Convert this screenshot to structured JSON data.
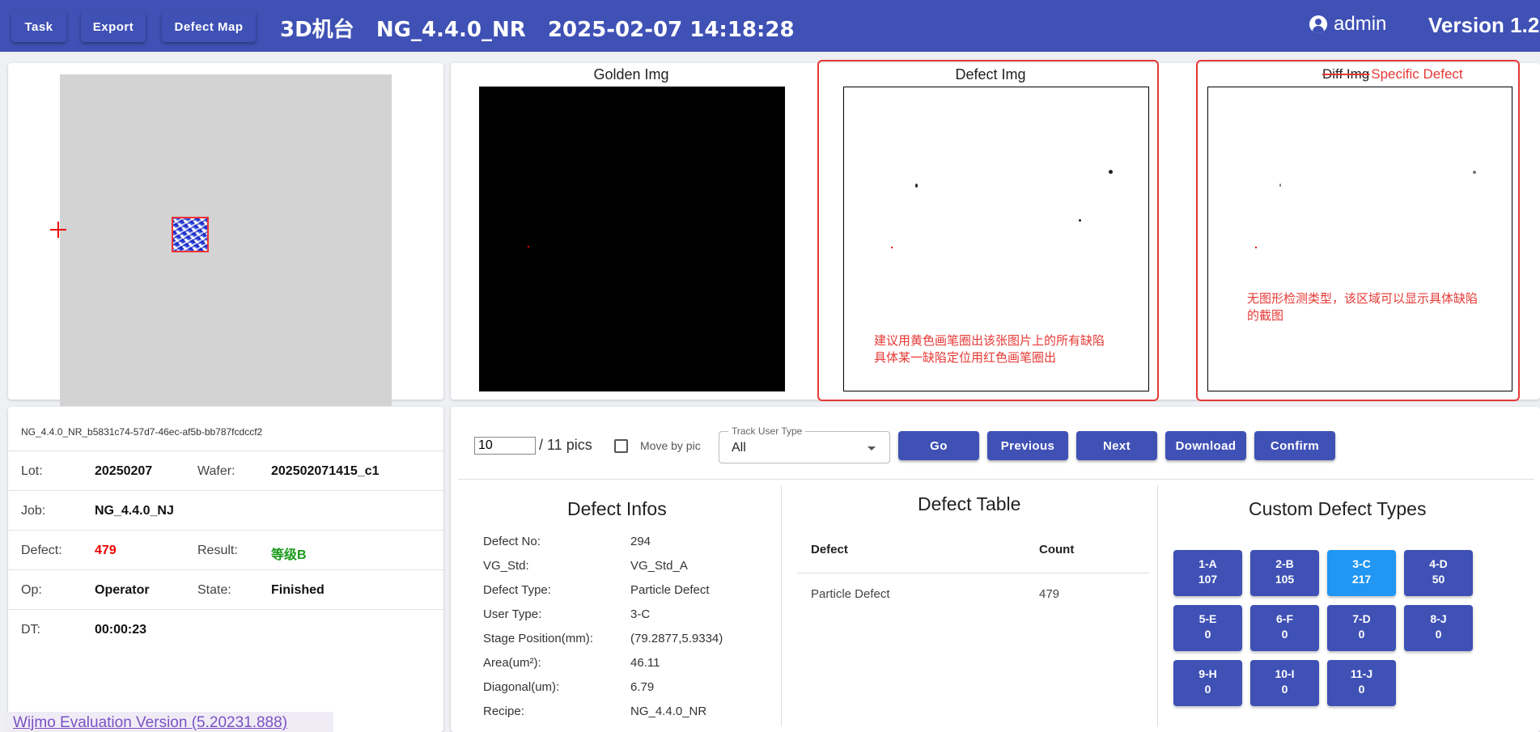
{
  "header": {
    "task_label": "Task",
    "export_label": "Export",
    "defect_map_label": "Defect Map",
    "title": "3D机台   NG_4.4.0_NR   2025-02-07 14:18:28",
    "user": "admin",
    "version": "Version 1.2",
    "bg_color": "#3f51b5"
  },
  "images": {
    "golden_title": "Golden Img",
    "defect_title": "Defect Img",
    "diff_title_strike": "Diff Img",
    "diff_title_specific": "Specific  Defect",
    "defect_note_line1": "建议用黄色画笔圈出该张图片上的所有缺陷",
    "defect_note_line2": "具体某一缺陷定位用红色画笔圈出",
    "diff_note_line1": "无图形检测类型，该区域可以显示具体缺陷",
    "diff_note_line2": "的截图"
  },
  "info": {
    "guid": "NG_4.4.0_NR_b5831c74-57d7-46ec-af5b-bb787fcdccf2",
    "lot_label": "Lot:",
    "lot": "20250207",
    "wafer_label": "Wafer:",
    "wafer": "202502071415_c1",
    "job_label": "Job:",
    "job": "NG_4.4.0_NJ",
    "defect_label": "Defect:",
    "defect": "479",
    "result_label": "Result:",
    "result": "等级B",
    "op_label": "Op:",
    "op": "Operator",
    "state_label": "State:",
    "state": "Finished",
    "dt_label": "DT:",
    "dt": "00:00:23"
  },
  "watermark": "Wijmo Evaluation Version (5.20231.888)",
  "controls": {
    "page_value": "10",
    "page_total": "/ 11 pics",
    "move_by_pic": "Move by pic",
    "track_legend": "Track User Type",
    "track_value": "All",
    "go": "Go",
    "previous": "Previous",
    "next": "Next",
    "download": "Download",
    "confirm": "Confirm"
  },
  "defect_infos": {
    "title": "Defect Infos",
    "rows": [
      {
        "k": "Defect No:",
        "v": "294"
      },
      {
        "k": "VG_Std:",
        "v": "VG_Std_A"
      },
      {
        "k": "Defect Type:",
        "v": "Particle Defect"
      },
      {
        "k": "User Type:",
        "v": "3-C"
      },
      {
        "k": "Stage Position(mm):",
        "v": "(79.2877,5.9334)"
      },
      {
        "k": "Area(um²):",
        "v": "46.11"
      },
      {
        "k": "Diagonal(um):",
        "v": "6.79"
      },
      {
        "k": "Recipe:",
        "v": "NG_4.4.0_NR"
      }
    ]
  },
  "defect_table": {
    "title": "Defect Table",
    "col_defect": "Defect",
    "col_count": "Count",
    "row_defect": "Particle Defect",
    "row_count": "479"
  },
  "custom_types": {
    "title": "Custom Defect Types",
    "items": [
      {
        "code": "1-A",
        "count": "107"
      },
      {
        "code": "2-B",
        "count": "105"
      },
      {
        "code": "3-C",
        "count": "217"
      },
      {
        "code": "4-D",
        "count": "50"
      },
      {
        "code": "5-E",
        "count": "0"
      },
      {
        "code": "6-F",
        "count": "0"
      },
      {
        "code": "7-D",
        "count": "0"
      },
      {
        "code": "8-J",
        "count": "0"
      },
      {
        "code": "9-H",
        "count": "0"
      },
      {
        "code": "10-I",
        "count": "0"
      },
      {
        "code": "11-J",
        "count": "0"
      }
    ],
    "active_color": "#2196f3"
  }
}
